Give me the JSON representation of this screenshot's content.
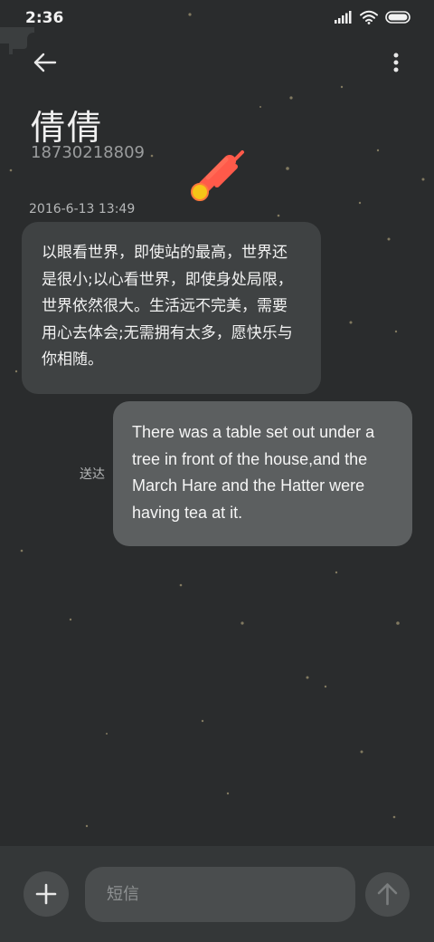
{
  "status_bar": {
    "time": "2:36",
    "icons": [
      "signal-icon",
      "wifi-icon",
      "battery-icon"
    ]
  },
  "header": {
    "back_icon": "back-arrow-icon",
    "more_icon": "more-vertical-icon",
    "contact_name": "倩倩",
    "contact_number": "18730218809"
  },
  "conversation": {
    "timestamp": "2016-6-13 13:49",
    "received_message": "以眼看世界，即使站的最高，世界还是很小;以心看世界，即使身处局限，世界依然很大。生活远不完美，需要用心去体会;无需拥有太多，愿快乐与你相随。",
    "sent_message": "There was a table set out under a tree in front of the house,and the March Hare and the Hatter were having tea at it.",
    "sent_status": "送达"
  },
  "composer": {
    "placeholder": "短信",
    "add_icon": "plus-icon",
    "send_icon": "send-arrow-icon"
  },
  "colors": {
    "background": "#2a2c2d",
    "received_bubble": "#3f4243",
    "sent_bubble": "#5c5f60",
    "composer_bar": "#343738",
    "meteor_tail": "#ff5a4a",
    "meteor_head": "#f5c518"
  }
}
